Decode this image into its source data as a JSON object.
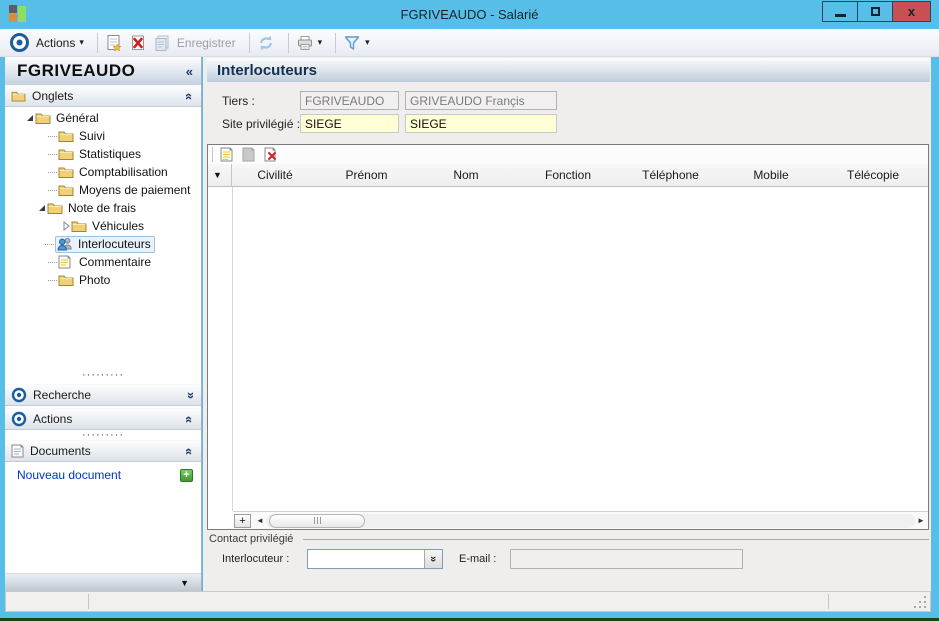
{
  "window": {
    "title": "FGRIVEAUDO -  Salarié"
  },
  "toolbar": {
    "actions_label": "Actions",
    "enregistrer_label": "Enregistrer"
  },
  "sidebar": {
    "header": "FGRIVEAUDO",
    "sections": {
      "onglets": "Onglets",
      "recherche": "Recherche",
      "actions": "Actions",
      "documents": "Documents"
    },
    "tree": [
      {
        "label": "Général"
      },
      {
        "label": "Suivi"
      },
      {
        "label": "Statistiques"
      },
      {
        "label": "Comptabilisation"
      },
      {
        "label": "Moyens de paiement"
      },
      {
        "label": "Note de frais"
      },
      {
        "label": "Véhicules"
      },
      {
        "label": "Interlocuteurs"
      },
      {
        "label": "Commentaire"
      },
      {
        "label": "Photo"
      }
    ],
    "nouveau_document": "Nouveau document"
  },
  "main": {
    "title": "Interlocuteurs",
    "fields": {
      "tiers_label": "Tiers :",
      "tiers_code": "FGRIVEAUDO",
      "tiers_name": "GRIVEAUDO Françis",
      "site_label": "Site privilégié :",
      "site_code": "SIEGE",
      "site_name": "SIEGE"
    },
    "grid": {
      "columns": [
        "Civilité",
        "Prénom",
        "Nom",
        "Fonction",
        "Téléphone",
        "Mobile",
        "Télécopie"
      ]
    },
    "contact": {
      "group_label": "Contact privilégié",
      "interlocuteur_label": "Interlocuteur :",
      "interlocuteur_value": "",
      "email_label": "E-mail :",
      "email_value": ""
    }
  },
  "icons": {
    "collapse": "«",
    "dropdown_caret": "▾",
    "row_marker": "▼",
    "sidebar_collapse": "▼",
    "plus_small": "+",
    "scroll_left": "◄",
    "scroll_right": "►",
    "combo_chevrons": "»",
    "dots": "·········",
    "close_glyph": "x"
  },
  "colors": {
    "titlebar_blue": "#57bfe7",
    "close_red": "#c75050",
    "accent_navy": "#1a3c64",
    "field_yellow": "#ffffd6",
    "selection_blue": "#e7f2fb",
    "link_blue": "#0033cc",
    "bottom_strip_green": "#1d441d"
  }
}
